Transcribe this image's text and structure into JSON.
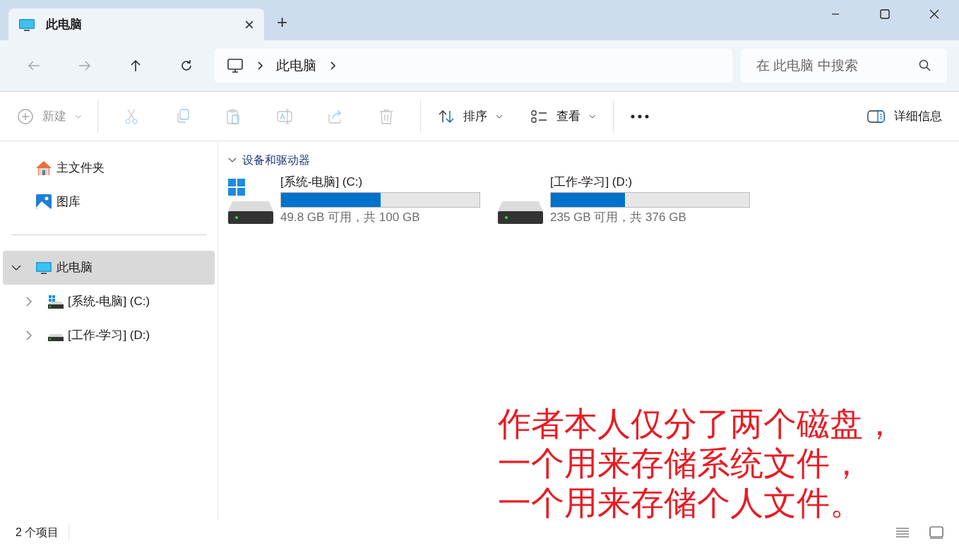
{
  "tab": {
    "title": "此电脑",
    "selected": true,
    "close": "×",
    "new_tab": "+"
  },
  "nav": [
    {
      "kind": "back",
      "disabled": true
    },
    {
      "kind": "forward",
      "disabled": true
    },
    {
      "kind": "up",
      "disabled": false
    },
    {
      "kind": "refresh",
      "disabled": false
    }
  ],
  "address": {
    "crumbs": [
      "此电脑"
    ]
  },
  "search": {
    "placeholder": "在 此电脑 中搜索"
  },
  "toolbar": {
    "new": {
      "label": "新建",
      "disabled": true
    },
    "actions": [
      {
        "kind": "cut",
        "disabled": true
      },
      {
        "kind": "copy",
        "disabled": true
      },
      {
        "kind": "paste",
        "disabled": true
      },
      {
        "kind": "rename",
        "disabled": true
      },
      {
        "kind": "share",
        "disabled": true
      },
      {
        "kind": "delete",
        "disabled": true
      }
    ],
    "sort": {
      "label": "排序"
    },
    "view": {
      "label": "查看"
    },
    "details": {
      "label": "详细信息"
    }
  },
  "sidebar": {
    "quick": [
      {
        "kind": "home",
        "label": "主文件夹"
      },
      {
        "kind": "gallery",
        "label": "图库"
      }
    ],
    "tree": [
      {
        "kind": "pc",
        "label": "此电脑",
        "expanded": true,
        "selected": true,
        "children": [
          {
            "kind": "system_drive",
            "label": "[系统-电脑] (C:)",
            "expanded": false,
            "selected": false
          },
          {
            "kind": "drive",
            "label": "[工作-学习] (D:)",
            "expanded": false,
            "selected": false
          }
        ]
      }
    ]
  },
  "content": {
    "group": {
      "title": "设备和驱动器",
      "expanded": true
    },
    "drives": [
      {
        "kind": "system_drive",
        "name": "[系统-电脑] (C:)",
        "level": 0.5,
        "space": "49.8 GB 可用，共 100 GB"
      },
      {
        "kind": "drive",
        "name": "[工作-学习] (D:)",
        "level": 0.375,
        "space": "235 GB 可用，共 376 GB"
      }
    ]
  },
  "status_bar": {
    "count": "2 个项目"
  },
  "annotation": {
    "lines": [
      "作者本人仅分了两个磁盘，",
      "一个用来存储系统文件，",
      "一个用来存储个人文件。"
    ]
  }
}
